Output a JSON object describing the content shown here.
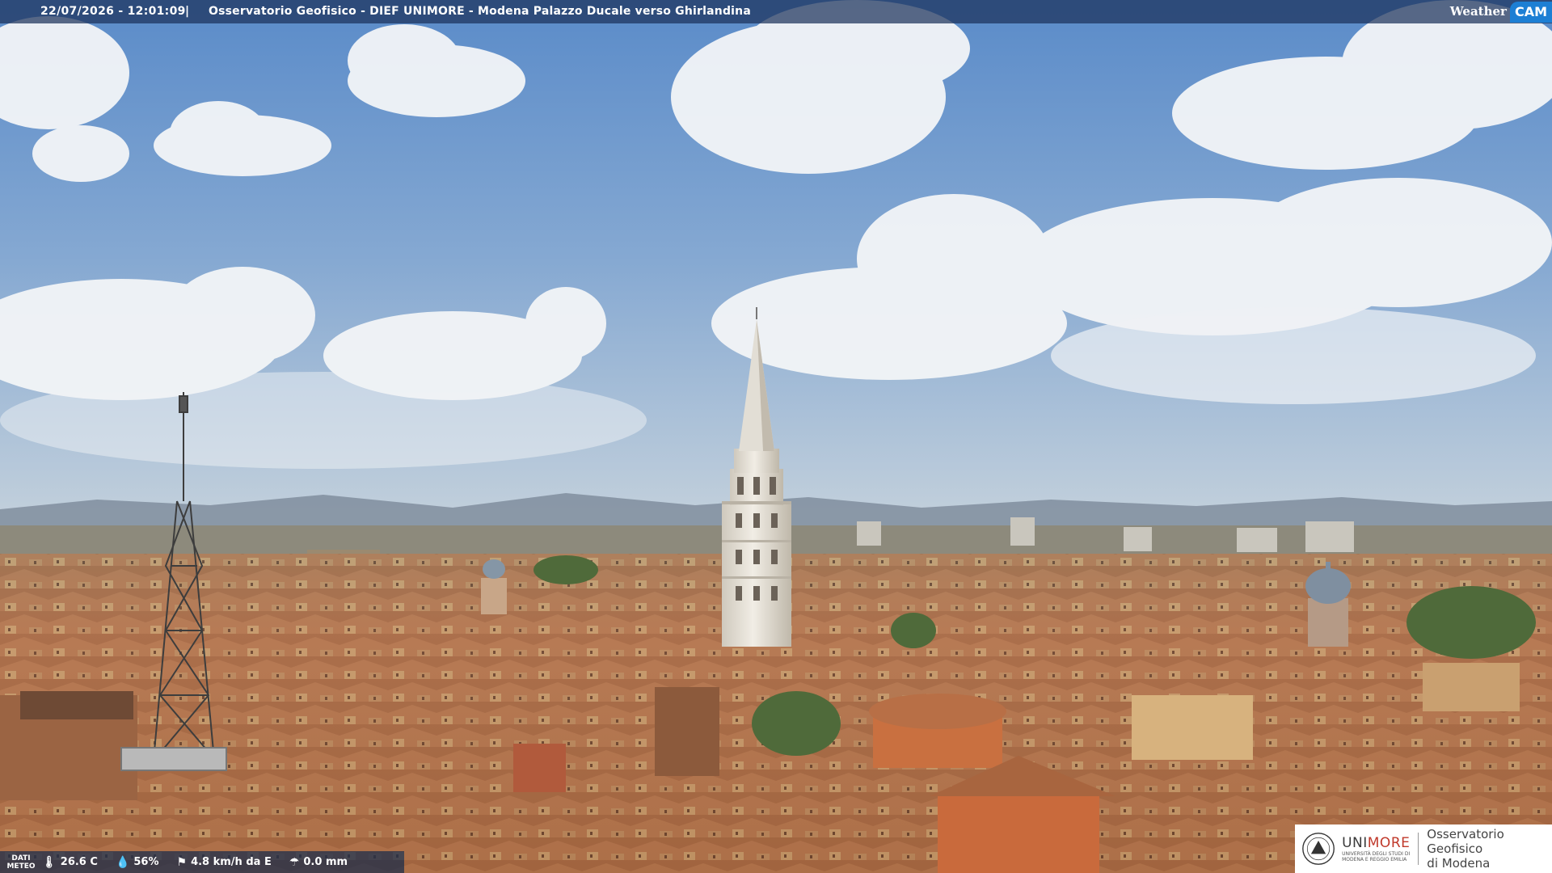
{
  "header": {
    "datetime": "22/07/2026 - 12:01:09",
    "separator": "|",
    "title": "Osservatorio Geofisico - DIEF UNIMORE - Modena Palazzo Ducale verso Ghirlandina"
  },
  "brand": {
    "weather": "Weather",
    "cam": "CAM",
    "accent": "#1d7fd4"
  },
  "meteo": {
    "label_line1": "DATI",
    "label_line2": "METEO",
    "temperature": "26.6 C",
    "humidity": "56%",
    "wind": "4.8 km/h da E",
    "rain": "0.0 mm",
    "icons": [
      "thermometer-icon",
      "humidity-drop-icon",
      "wind-icon",
      "rain-icon"
    ]
  },
  "logo": {
    "uni_prefix": "UNI",
    "uni_suffix": "MORE",
    "uni_sub1": "UNIVERSITÀ DEGLI STUDI DI",
    "uni_sub2": "MODENA E REGGIO EMILIA",
    "obs_line1": "Osservatorio Geofisico",
    "obs_line2": "di Modena"
  },
  "colors": {
    "sky_top": "#5f8fcb",
    "sky_bottom": "#b9cbdb",
    "roof": "#b4744a",
    "tower": "#e9e5dc"
  }
}
